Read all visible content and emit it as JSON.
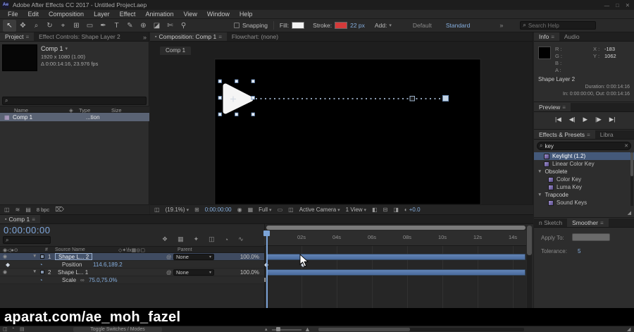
{
  "titlebar": {
    "app_icon": "Ae",
    "title": "Adobe After Effects CC 2017 - Untitled Project.aep",
    "minimize": "—",
    "maximize": "□",
    "close": "✕"
  },
  "menubar": {
    "items": [
      "File",
      "Edit",
      "Composition",
      "Layer",
      "Effect",
      "Animation",
      "View",
      "Window",
      "Help"
    ]
  },
  "toolbar": {
    "tools": [
      {
        "glyph": "↖"
      },
      {
        "glyph": "✥"
      },
      {
        "glyph": "⌕"
      },
      {
        "glyph": "↻"
      },
      {
        "glyph": "⌖"
      },
      {
        "glyph": "⊞"
      },
      {
        "glyph": "▭"
      },
      {
        "glyph": "✒"
      },
      {
        "glyph": "T"
      },
      {
        "glyph": "✎"
      },
      {
        "glyph": "⊕"
      },
      {
        "glyph": "◪"
      },
      {
        "glyph": "✄"
      },
      {
        "glyph": "⚲"
      }
    ],
    "snapping_label": "Snapping",
    "fill_label": "Fill:",
    "stroke_label": "Stroke:",
    "stroke_width": "22 px",
    "add_label": "Add:",
    "default_label": "Default",
    "workspace": "Standard",
    "search_placeholder": "Search Help"
  },
  "project": {
    "tab_project": "Project",
    "tab_effect_controls": "Effect Controls: Shape Layer 2",
    "comp_name": "Comp 1",
    "comp_info1": "1920 x 1080 (1.00)",
    "comp_info2": "Δ 0:00:14:16, 23.976 fps",
    "col_name": "Name",
    "col_type": "Type",
    "col_size": "Size",
    "row_name": "Comp 1",
    "row_type": "...tion",
    "bpc": "8 bpc"
  },
  "composition": {
    "tab_composition": "Composition: Comp 1",
    "tab_flowchart": "Flowchart: (none)",
    "viewer_tab": "Comp 1",
    "zoom": "(19.1%)",
    "timecode": "0:00:00:00",
    "resolution": "Full",
    "camera": "Active Camera",
    "views": "1 View",
    "exposure": "+0.0"
  },
  "info": {
    "tab_info": "Info",
    "tab_audio": "Audio",
    "r": "R :",
    "g": "G :",
    "b": "B :",
    "a": "A :",
    "x": "X :",
    "x_value": "-183",
    "y": "Y :",
    "y_value": "1062",
    "layer_name": "Shape Layer 2",
    "duration": "Duration: 0:00:14:16",
    "in_out": "In: 0:00:00:00, Out: 0:00:14:16"
  },
  "preview": {
    "title": "Preview",
    "buttons": [
      "|◀",
      "◀|",
      "▶",
      "|▶",
      "▶|"
    ]
  },
  "effects": {
    "tab_effects": "Effects & Presets",
    "tab_libraries": "Libra",
    "search_value": "key",
    "items": [
      {
        "label": "Keylight (1.2)"
      },
      {
        "label": "Linear Color Key"
      },
      {
        "label": "Obsolete"
      },
      {
        "label": "Color Key"
      },
      {
        "label": "Luma Key"
      },
      {
        "label": "Trapcode"
      },
      {
        "label": "Sound Keys"
      }
    ]
  },
  "smoother": {
    "tab_sketch": "n Sketch",
    "tab_smoother": "Smoother",
    "apply_to": "Apply To:",
    "tolerance_label": "Tolerance:",
    "tolerance_value": "5"
  },
  "timeline": {
    "tab": "Comp 1",
    "timecode": "0:00:00:00",
    "col_hash": "#",
    "col_source_name": "Source Name",
    "col_parent": "Parent",
    "layer1": {
      "num": "1",
      "name": "Shape L... 2",
      "parent": "None",
      "stretch": "100.0%"
    },
    "prop1": {
      "name": "Position",
      "value": "114.6,189.2"
    },
    "layer2": {
      "num": "2",
      "name": "Shape L... 1",
      "parent": "None",
      "stretch": "100.0%"
    },
    "prop2": {
      "name": "Scale",
      "value": "75.0,75.0%"
    },
    "ruler": [
      "02s",
      "04s",
      "06s",
      "08s",
      "10s",
      "12s",
      "14s"
    ],
    "toggle_label": "Toggle Switches / Modes"
  },
  "watermark": "aparat.com/ae_moh_fazel",
  "icons": {
    "panel_menu": "≡",
    "more": "»",
    "search": "⌕",
    "dropdown": "▾",
    "clear": "✕",
    "folder_open": "▼",
    "expand": "▼",
    "eye": "◉",
    "pickwhip": "@",
    "stopwatch": "◔",
    "link": "∞",
    "keyframe": "◆",
    "trash": "⌦",
    "grid": "⊞",
    "channels": "▦",
    "snapshot": "◉",
    "roi": "▭",
    "transparency": "◫",
    "view_a": "◧",
    "view_b": "⊟",
    "view_c": "◨",
    "exposure": "◐",
    "switch_cluster": "◇✦\\fx▦◎▢",
    "av_cluster": "◉◁●⊙",
    "comp_chip": "▪",
    "flowchart": "❖",
    "draft3d": "▦",
    "shy": "✦",
    "frameblend": "◫",
    "motionblur": "◔",
    "graph": "∿",
    "mountain_small": "▴",
    "mountain_large": "▲",
    "grip": "◢",
    "checker": "◫",
    "waves": "≋",
    "list": "▤",
    "sort": "◈",
    "ibeam": "I"
  },
  "colors": {
    "accent_blue": "#85aede",
    "bar_blue": "#52749f",
    "selection": "#44597a",
    "stroke_red": "#d43a3a"
  }
}
